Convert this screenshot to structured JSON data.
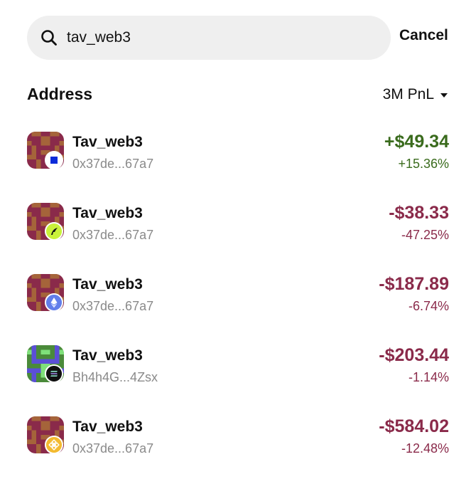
{
  "search": {
    "value": "tav_web3",
    "cancel_label": "Cancel"
  },
  "header": {
    "title": "Address",
    "filter_label": "3M PnL"
  },
  "results": [
    {
      "name": "Tav_web3",
      "address": "0x37de...67a7",
      "pnl": "+$49.34",
      "pnl_pct": "+15.36%",
      "trend": "positive",
      "chain_icon": "base-chain-icon",
      "avatar_palette": "maroon"
    },
    {
      "name": "Tav_web3",
      "address": "0x37de...67a7",
      "pnl": "-$38.33",
      "pnl_pct": "-47.25%",
      "trend": "negative",
      "chain_icon": "robinhood-chain-icon",
      "avatar_palette": "maroon"
    },
    {
      "name": "Tav_web3",
      "address": "0x37de...67a7",
      "pnl": "-$187.89",
      "pnl_pct": "-6.74%",
      "trend": "negative",
      "chain_icon": "ethereum-icon",
      "avatar_palette": "maroon"
    },
    {
      "name": "Tav_web3",
      "address": "Bh4h4G...4Zsx",
      "pnl": "-$203.44",
      "pnl_pct": "-1.14%",
      "trend": "negative",
      "chain_icon": "solana-icon",
      "avatar_palette": "green"
    },
    {
      "name": "Tav_web3",
      "address": "0x37de...67a7",
      "pnl": "-$584.02",
      "pnl_pct": "-12.48%",
      "trend": "negative",
      "chain_icon": "bnb-chain-icon",
      "avatar_palette": "maroon"
    }
  ],
  "colors": {
    "positive": "#3a6b1d",
    "negative": "#8a2a4a",
    "muted": "#8a8a8a",
    "search_bg": "#efefef"
  }
}
